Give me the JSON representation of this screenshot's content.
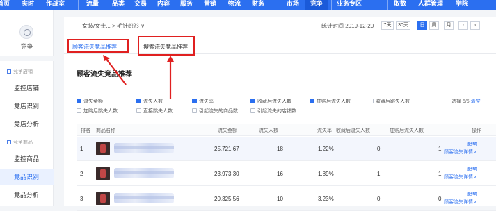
{
  "topnav": {
    "items": [
      "首页",
      "实时",
      "作战室",
      "流量",
      "品类",
      "交易",
      "内容",
      "服务",
      "营销",
      "物流",
      "财务",
      "市场",
      "竞争",
      "业务专区",
      "取数",
      "人群管理",
      "学院"
    ],
    "active": "竞争"
  },
  "sidebar": {
    "title": "竞争",
    "groups": [
      {
        "label": "竞争店铺",
        "items": [
          "监控店铺",
          "竞店识别",
          "竞店分析"
        ]
      },
      {
        "label": "竞争商品",
        "items": [
          "监控商品",
          "竞品识别",
          "竞品分析"
        ]
      }
    ],
    "active_item": "竞品识别"
  },
  "header": {
    "breadcrumb": "女装/女士... > 毛针织衫 ∨",
    "stat_time": "统计时间 2019-12-20",
    "ranges": [
      "7天",
      "30天",
      "日",
      "周",
      "月"
    ],
    "active_range": "日",
    "prev_arrow": "‹",
    "next_arrow": "›"
  },
  "tabs": [
    {
      "label": "顾客流失竞品推荐",
      "active": true
    },
    {
      "label": "搜索流失竞品推荐",
      "active": false
    }
  ],
  "section": {
    "title": "顾客流失竞品推荐"
  },
  "filters": {
    "row1": [
      {
        "label": "流失金额",
        "checked": true
      },
      {
        "label": "流失人数",
        "checked": true
      },
      {
        "label": "流失率",
        "checked": true
      },
      {
        "label": "收藏后流失人数",
        "checked": true
      },
      {
        "label": "加购后流失人数",
        "checked": true
      },
      {
        "label": "收藏后跳失人数",
        "checked": false
      }
    ],
    "row2": [
      {
        "label": "加购后跳失人数",
        "checked": false
      },
      {
        "label": "直接跳失人数",
        "checked": false
      },
      {
        "label": "引起流失的商品数",
        "checked": false
      },
      {
        "label": "引起流失的店铺数",
        "checked": false
      }
    ],
    "selected_text": "选择 5/5",
    "clear_label": "清空"
  },
  "table": {
    "columns": [
      "排名",
      "商品名称",
      "流失金额",
      "流失人数",
      "流失率",
      "收藏后流失人数",
      "加购后流失人数",
      "操作"
    ],
    "rows": [
      {
        "rank": "1",
        "amount": "25,721.67",
        "people": "18",
        "rate": "1.22%",
        "fav_lost": "0",
        "cart_lost": "1",
        "trend": "趋势",
        "detail": "顾客流失详情∨"
      },
      {
        "rank": "2",
        "amount": "23,973.30",
        "people": "16",
        "rate": "1.89%",
        "fav_lost": "1",
        "cart_lost": "1",
        "trend": "趋势",
        "detail": "顾客流失详情∨"
      },
      {
        "rank": "3",
        "amount": "20,325.56",
        "people": "10",
        "rate": "3.23%",
        "fav_lost": "0",
        "cart_lost": "0",
        "trend": "趋势",
        "detail": "顾客流失详情∨"
      }
    ]
  },
  "colors": {
    "brand": "#2b6ff0",
    "highlight": "#e02020"
  }
}
